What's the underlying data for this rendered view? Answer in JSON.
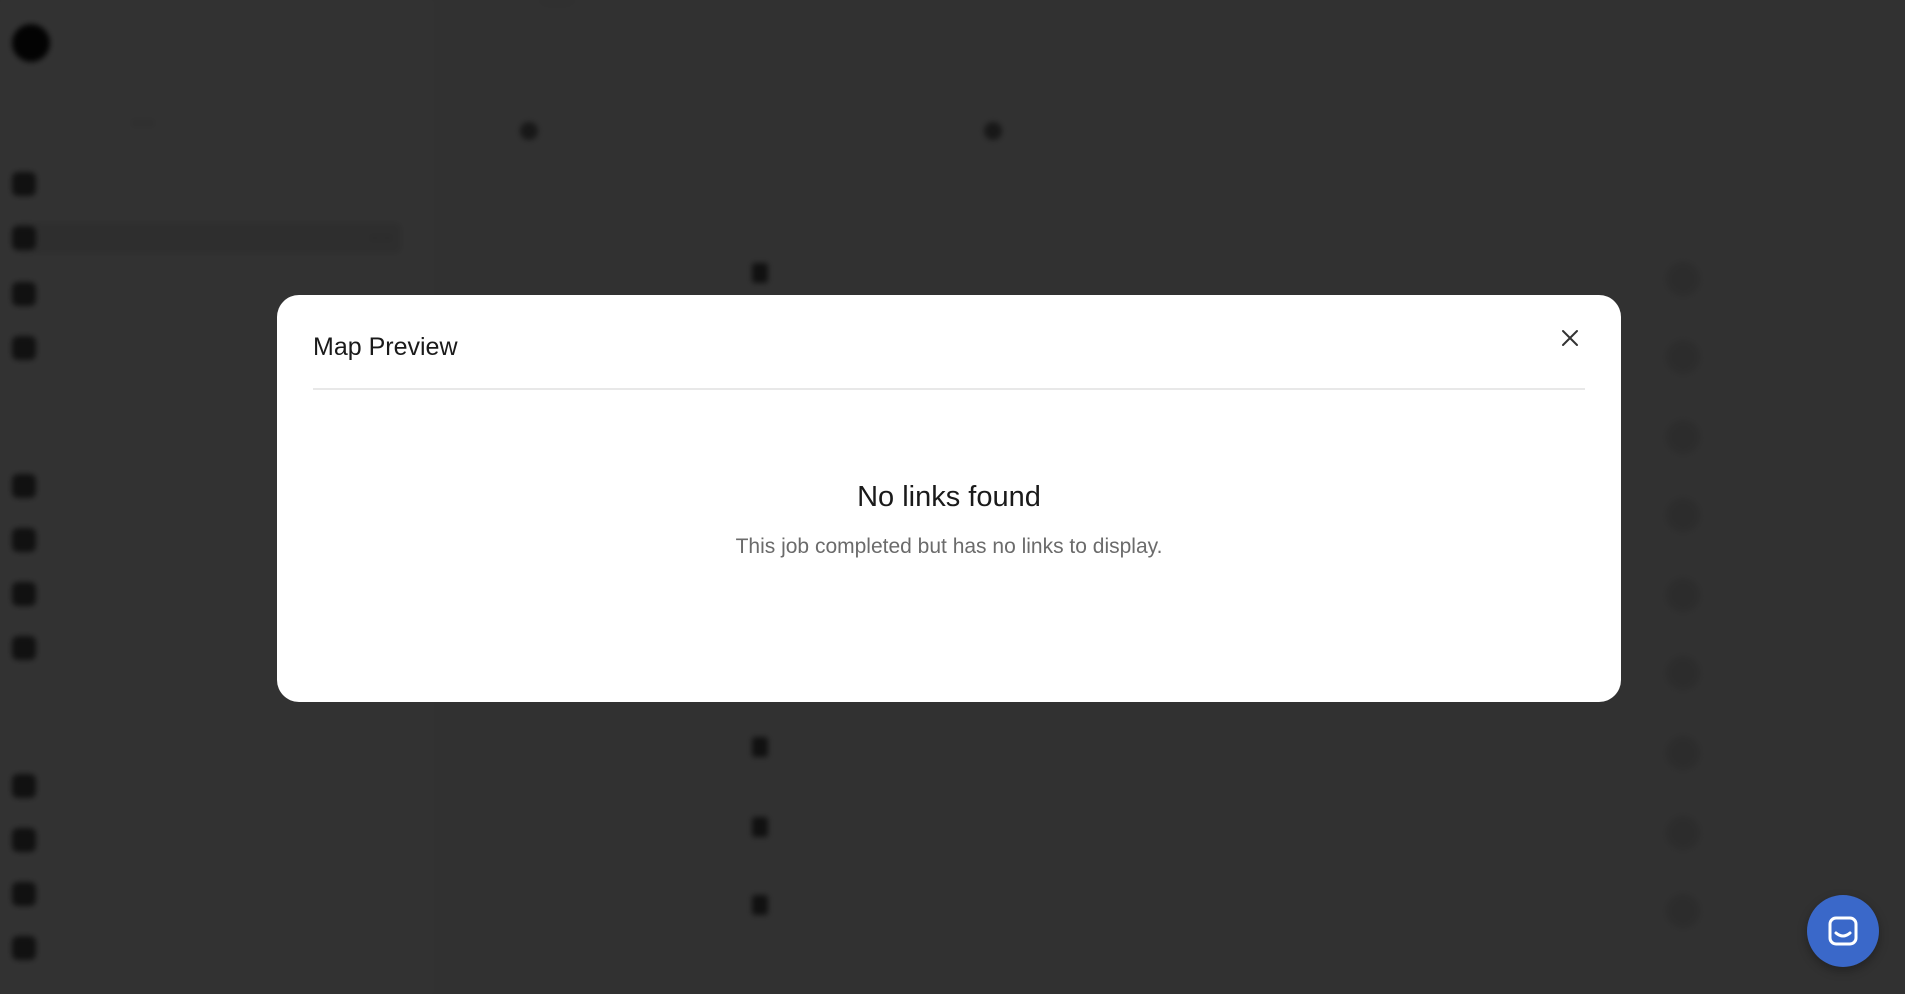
{
  "modal": {
    "title": "Map Preview",
    "empty_title": "No links found",
    "empty_description": "This job completed but has no links to display."
  },
  "colors": {
    "overlay": "rgba(0,0,0,0.8)",
    "modal_bg": "#ffffff",
    "chat_button": "#3a68c9"
  },
  "icons": {
    "close": "close-icon",
    "chat": "chat-icon"
  }
}
